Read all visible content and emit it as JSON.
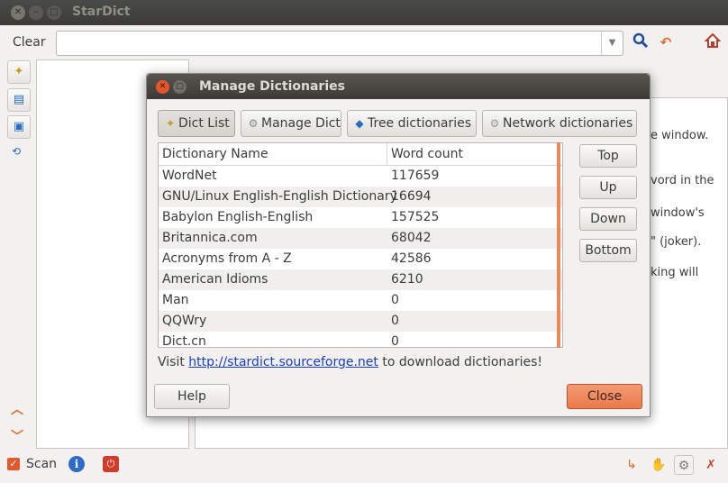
{
  "window": {
    "title": "StarDict"
  },
  "toolbar": {
    "clear_label": "Clear",
    "search_value": "",
    "search_placeholder": ""
  },
  "content": {
    "fragments": [
      "e window.",
      "vord in the",
      "window's",
      "\" (joker).",
      "king will"
    ]
  },
  "statusbar": {
    "scan_label": "Scan",
    "scan_checked": true
  },
  "dialog": {
    "title": "Manage Dictionaries",
    "tabs": [
      {
        "label": "Dict List",
        "icon": "wand-icon",
        "active": true
      },
      {
        "label": "Manage Dict",
        "icon": "gear-icon",
        "active": false
      },
      {
        "label": "Tree dictionaries",
        "icon": "book-icon",
        "active": false
      },
      {
        "label": "Network dictionaries",
        "icon": "network-gear-icon",
        "active": false
      }
    ],
    "table": {
      "columns": [
        "Dictionary Name",
        "Word count"
      ],
      "rows": [
        {
          "name": "WordNet",
          "count": "117659"
        },
        {
          "name": "GNU/Linux English-English Dictionary",
          "count": "16694"
        },
        {
          "name": "Babylon English-English",
          "count": "157525"
        },
        {
          "name": "Britannica.com",
          "count": "68042"
        },
        {
          "name": "Acronyms from A - Z",
          "count": "42586"
        },
        {
          "name": "American Idioms",
          "count": "6210"
        },
        {
          "name": "Man",
          "count": "0"
        },
        {
          "name": "QQWry",
          "count": "0"
        },
        {
          "name": "Dict.cn",
          "count": "0"
        }
      ]
    },
    "side_buttons": [
      "Top",
      "Up",
      "Down",
      "Bottom"
    ],
    "visit_prefix": "Visit",
    "visit_link": "http://stardict.sourceforge.net",
    "visit_suffix": "to download dictionaries!",
    "help_label": "Help",
    "close_label": "Close"
  },
  "colors": {
    "accent": "#eb7a4c",
    "link": "#1a3ec7",
    "titlebar": "#3c3b37"
  }
}
